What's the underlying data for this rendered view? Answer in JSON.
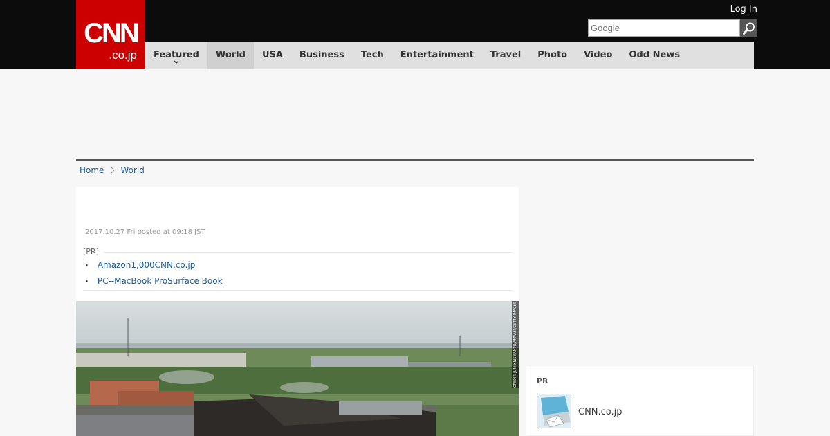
{
  "header": {
    "logo_main": "CNN",
    "logo_sub": ".co.jp",
    "login": "Log In",
    "search_placeholder": "Google"
  },
  "nav": {
    "items": [
      {
        "label": "Featured"
      },
      {
        "label": "World"
      },
      {
        "label": "USA"
      },
      {
        "label": "Business"
      },
      {
        "label": "Tech"
      },
      {
        "label": "Entertainment"
      },
      {
        "label": "Travel"
      },
      {
        "label": "Photo"
      },
      {
        "label": "Video"
      },
      {
        "label": "Odd News"
      }
    ]
  },
  "breadcrumb": {
    "home": "Home",
    "current": "World"
  },
  "article": {
    "date": "2017.10.27 Fri posted at 09:18 JST",
    "pr_label": "[PR]",
    "pr_links": [
      {
        "bullet": "・",
        "text": "Amazon1,000CNN.co.jp"
      },
      {
        "bullet": "・",
        "text": "PC--MacBook ProSurface Book"
      }
    ],
    "photo_credit": "CREDIT: JUNI KRISWANTO/AFP/AFP/GETTY IMAGES"
  },
  "sidebar": {
    "pr_title": "PR",
    "pr_item": "CNN.co.jp"
  },
  "colors": {
    "brand_red": "#cc0000",
    "header_bg": "#0c0c0c",
    "nav_bg": "#e0e0e0",
    "link": "#1a5c9a"
  }
}
